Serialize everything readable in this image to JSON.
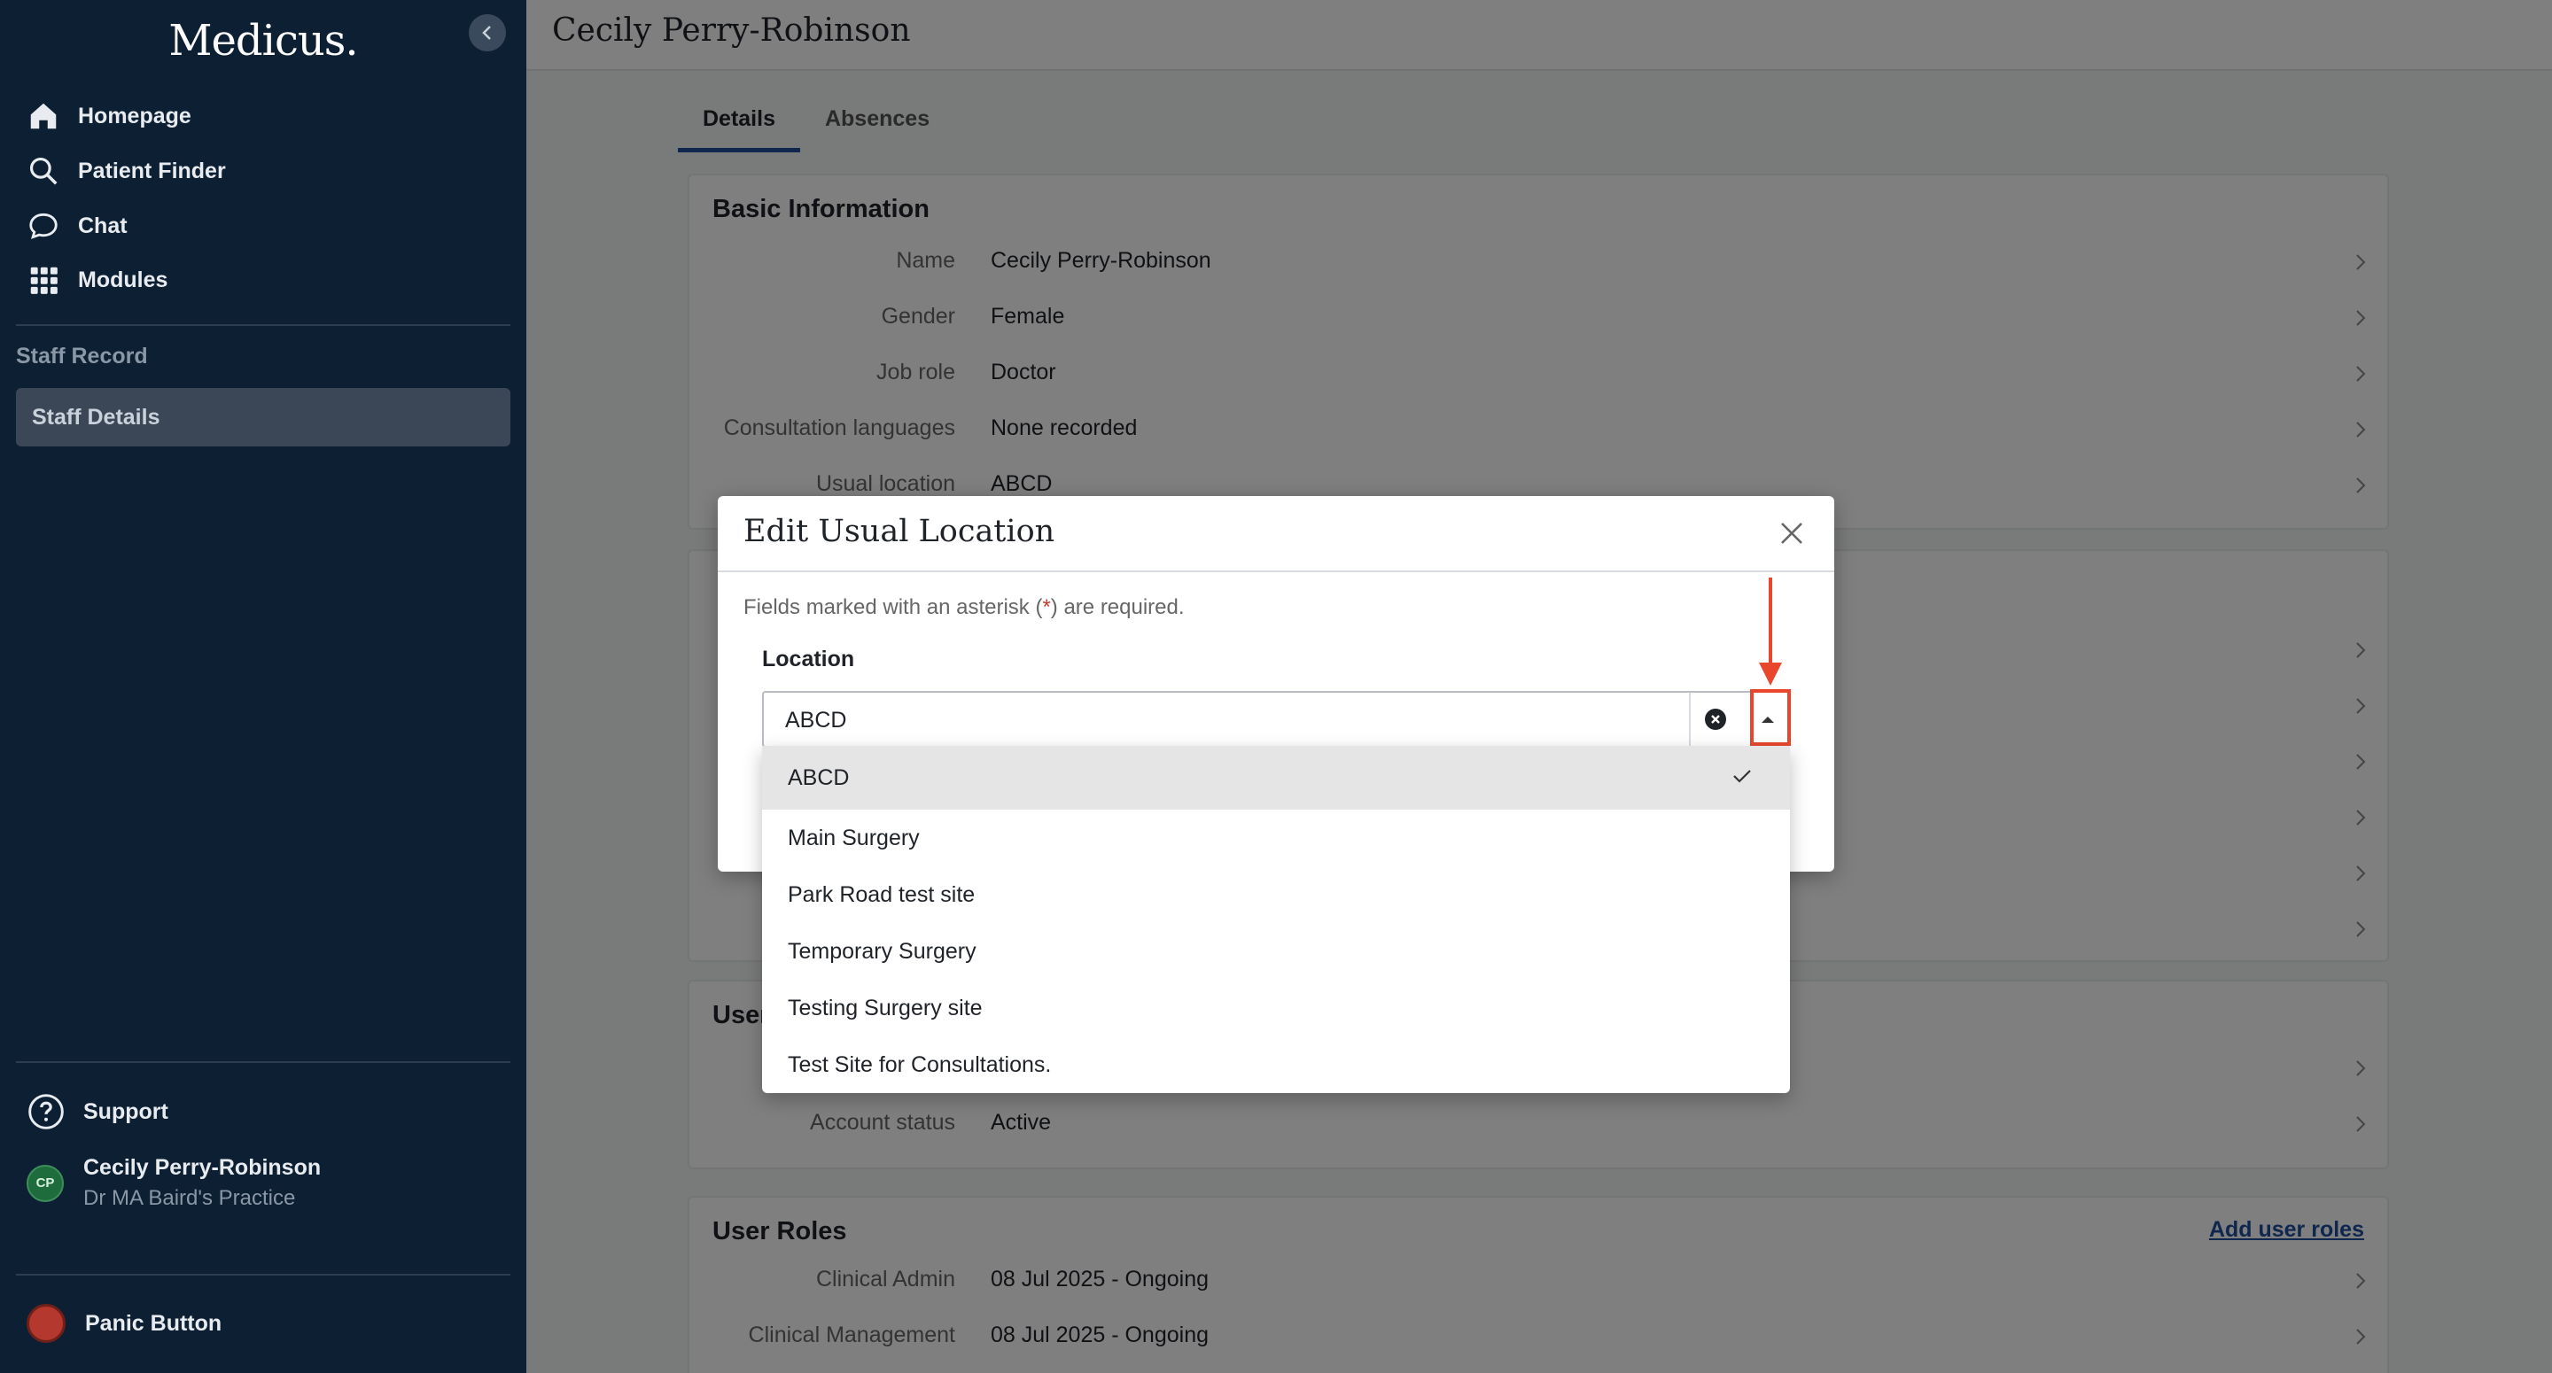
{
  "sidebar": {
    "logo": "Medicus.",
    "nav": [
      {
        "label": "Homepage",
        "icon": "home-icon"
      },
      {
        "label": "Patient Finder",
        "icon": "search-icon"
      },
      {
        "label": "Chat",
        "icon": "chat-icon"
      },
      {
        "label": "Modules",
        "icon": "grid-icon"
      }
    ],
    "section_title": "Staff Record",
    "active_item": "Staff Details",
    "support_label": "Support",
    "user": {
      "initials": "CP",
      "name": "Cecily Perry-Robinson",
      "practice": "Dr MA Baird's Practice"
    },
    "panic_label": "Panic Button"
  },
  "header": {
    "title": "Cecily Perry-Robinson"
  },
  "tabs": [
    {
      "label": "Details",
      "active": true
    },
    {
      "label": "Absences",
      "active": false
    }
  ],
  "basic_info": {
    "title": "Basic Information",
    "rows": [
      {
        "label": "Name",
        "value": "Cecily Perry-Robinson"
      },
      {
        "label": "Gender",
        "value": "Female"
      },
      {
        "label": "Job role",
        "value": "Doctor"
      },
      {
        "label": "Consultation languages",
        "value": "None recorded"
      },
      {
        "label": "Usual location",
        "value": "ABCD"
      }
    ]
  },
  "user_card": {
    "title_partial": "User",
    "rows": [
      {
        "label": "Account status",
        "value": "Active"
      }
    ]
  },
  "user_roles": {
    "title": "User Roles",
    "add_link": "Add user roles",
    "rows": [
      {
        "label": "Clinical Admin",
        "value": "08 Jul 2025 - Ongoing"
      },
      {
        "label": "Clinical Management",
        "value": "08 Jul 2025 - Ongoing"
      }
    ]
  },
  "modal": {
    "title": "Edit Usual Location",
    "hint_before": "Fields marked with an asterisk (",
    "hint_asterisk": "*",
    "hint_after": ") are required.",
    "field_label": "Location",
    "selected_value": "ABCD",
    "options": [
      "ABCD",
      "Main Surgery",
      "Park Road test site",
      "Temporary Surgery",
      "Testing Surgery site",
      "Test Site for Consultations."
    ]
  },
  "colors": {
    "sidebar_bg": "#0d1f33",
    "accent": "#1e4f9c",
    "annotation": "#e8472e"
  }
}
